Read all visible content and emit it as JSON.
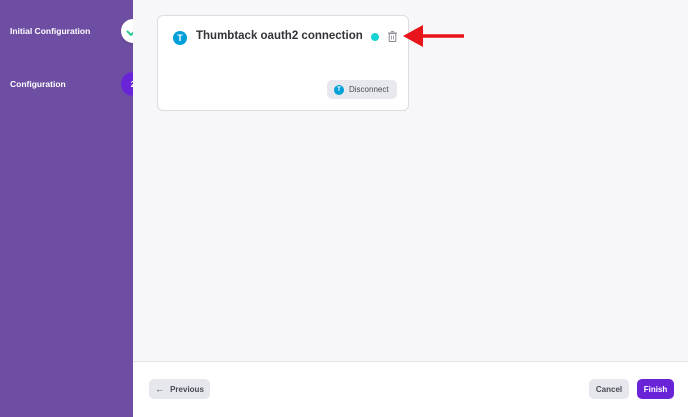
{
  "sidebar": {
    "steps": [
      {
        "label": "Initial Configuration",
        "status": "completed",
        "icon": "check-icon"
      },
      {
        "label": "Configuration",
        "number": "2",
        "status": "active"
      }
    ]
  },
  "connection_card": {
    "logo_letter": "T",
    "title": "Thumbtack oauth2 connection",
    "status_color": "#16d3d3",
    "delete_icon": "trash-icon",
    "disconnect_label": "Disconnect"
  },
  "footer": {
    "previous_label": "Previous",
    "previous_icon": "arrow-left-icon",
    "cancel_label": "Cancel",
    "finish_label": "Finish"
  },
  "colors": {
    "sidebar": "#6e4ea3",
    "accent": "#6a24d8",
    "thumbtack_brand": "#009fd9",
    "annotation": "#e8141b"
  }
}
